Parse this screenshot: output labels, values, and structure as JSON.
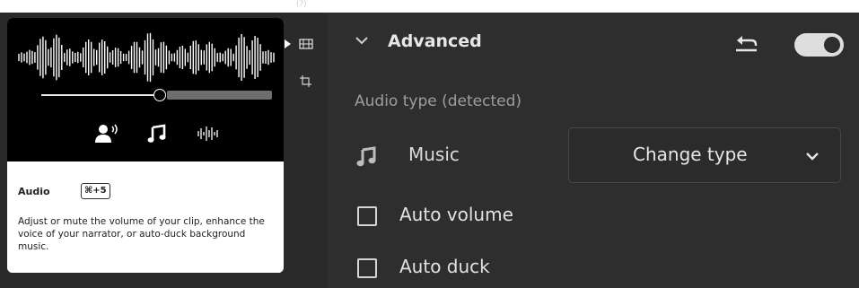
{
  "tooltip": {
    "title": "Audio",
    "shortcut": "⌘+5",
    "description": "Adjust or mute the volume of your clip, enhance the voice of your narrator, or auto-duck background music.",
    "preview_icons": [
      "voice-icon",
      "music-note-icon",
      "waveform-icon"
    ]
  },
  "toolbar": {
    "top_label": "(?)",
    "tools": [
      "audio-tool-icon",
      "crop-tool-icon"
    ]
  },
  "panel": {
    "section_title": "Advanced",
    "toggle_on": true,
    "audio_type_label": "Audio type (detected)",
    "audio_type_value": "Music",
    "change_type_label": "Change type",
    "checkboxes": [
      {
        "label": "Auto volume",
        "checked": false
      },
      {
        "label": "Auto duck",
        "checked": false
      }
    ]
  },
  "colors": {
    "panel_bg": "#2e2e2e",
    "card_bg": "#ffffff",
    "preview_bg": "#000000",
    "text_primary": "#e6e6e6",
    "text_muted": "#9e9e9e"
  }
}
